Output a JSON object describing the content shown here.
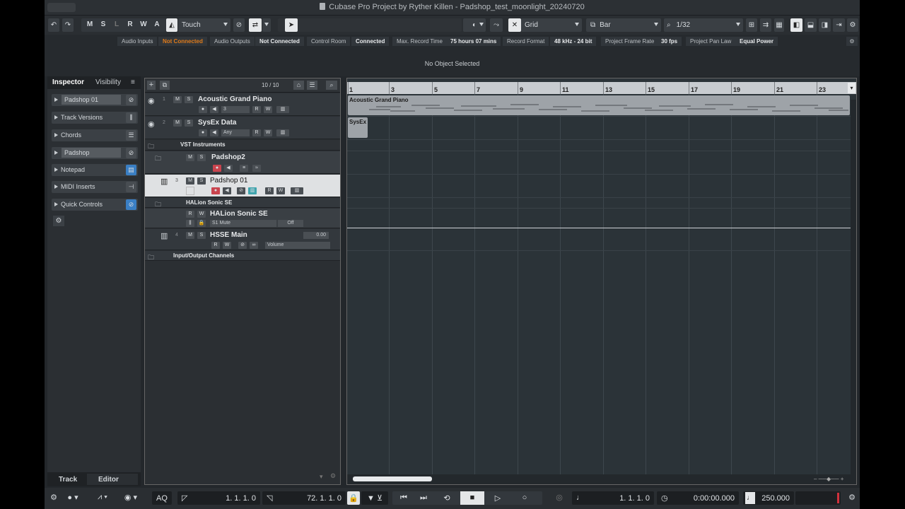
{
  "window": {
    "title": "Cubase Pro Project by Ryther Killen - Padshop_test_moonlight_20240720"
  },
  "toolbar": {
    "mode_buttons": [
      "M",
      "S",
      "L",
      "R",
      "W",
      "A"
    ],
    "automation_mode": "Touch",
    "snap_type": "Grid",
    "grid_type": "Bar",
    "quantize": "1/32"
  },
  "status": {
    "audio_inputs_label": "Audio Inputs",
    "audio_inputs_value": "Not Connected",
    "audio_outputs_label": "Audio Outputs",
    "audio_outputs_value": "Not Connected",
    "control_room_label": "Control Room",
    "control_room_value": "Connected",
    "max_record_label": "Max. Record Time",
    "max_record_value": "75 hours 07 mins",
    "record_format_label": "Record Format",
    "record_format_value": "48 kHz - 24 bit",
    "frame_rate_label": "Project Frame Rate",
    "frame_rate_value": "30 fps",
    "pan_law_label": "Project Pan Law",
    "pan_law_value": "Equal Power"
  },
  "info_line": "No Object Selected",
  "inspector": {
    "tabs": [
      "Inspector",
      "Visibility"
    ],
    "items": [
      {
        "label": "Padshop 01"
      },
      {
        "label": "Track Versions"
      },
      {
        "label": "Chords"
      },
      {
        "label": "Padshop"
      },
      {
        "label": "Notepad"
      },
      {
        "label": "MIDI Inserts"
      },
      {
        "label": "Quick Controls"
      }
    ],
    "bottom_tabs": [
      "Track",
      "Editor"
    ]
  },
  "tracklist": {
    "count": "10 / 10",
    "tracks": {
      "t1": {
        "num": "1",
        "name": "Acoustic Grand Piano",
        "channel": "3"
      },
      "t2": {
        "num": "2",
        "name": "SysEx Data",
        "channel": "Any"
      },
      "folder_vst": {
        "name": "VST Instruments"
      },
      "padshop2": {
        "name": "Padshop2"
      },
      "t3": {
        "num": "3",
        "name": "Padshop 01"
      },
      "folder_halion": {
        "name": "HALion Sonic SE"
      },
      "halion": {
        "name": "HALion Sonic SE",
        "param": "S1 Mute",
        "param_value": "Off"
      },
      "t4": {
        "num": "4",
        "name": "HSSE Main",
        "level": "0.00",
        "param": "Volume"
      },
      "folder_io": {
        "name": "Input/Output Channels"
      }
    }
  },
  "ruler": {
    "bars": [
      "1",
      "3",
      "5",
      "7",
      "9",
      "11",
      "13",
      "15",
      "17",
      "19",
      "21",
      "23"
    ]
  },
  "parts": {
    "piano_label": "Acoustic Grand Piano",
    "sysex_label": "SysEx"
  },
  "transport": {
    "aq_label": "AQ",
    "left_locator": "1.  1.  1.   0",
    "right_locator": "72.  1.  1.   0",
    "primary_time": "1.  1.  1.   0",
    "secondary_time": "0:00:00.000",
    "tempo": "250.000"
  }
}
